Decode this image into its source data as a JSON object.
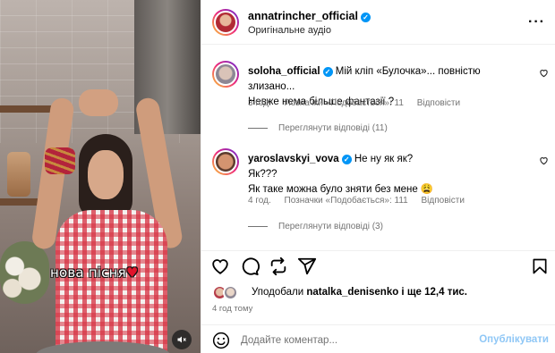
{
  "media": {
    "caption_text": "нова пісня",
    "caption_heart": "♥",
    "mute_icon": "speaker-muted-icon"
  },
  "post": {
    "author": "annatrincher_official",
    "audio_label": "Оригінальне аудіо",
    "more_icon": "more-horizontal-icon"
  },
  "comments": [
    {
      "username": "soloha_official",
      "verified": true,
      "text": "Мій кліп «Булочка»... повністю злизано...",
      "text_line2": "Невже нема більше фантазії ?",
      "time": "3 год.",
      "likes_label": "Позначки «Подобається»: 11",
      "reply_label": "Відповісти",
      "view_replies": "Переглянути відповіді (11)"
    },
    {
      "username": "yaroslavskyi_vova",
      "verified": true,
      "text": "Не ну як як?",
      "text_line2": "Як???",
      "text_line3": "Як таке можна було зняти без мене 😩",
      "time": "4 год.",
      "likes_label": "Позначки «Подобається»: 111",
      "reply_label": "Відповісти",
      "view_replies": "Переглянути відповіді (3)"
    }
  ],
  "actions": {
    "like_icon": "heart-icon",
    "comment_icon": "comment-icon",
    "repost_icon": "repost-icon",
    "share_icon": "send-icon",
    "save_icon": "bookmark-icon"
  },
  "likes": {
    "prefix": "Уподобали ",
    "user": "natalka_denisenko",
    "suffix": " і ще 12,4 тис."
  },
  "time_ago": "4 год тому",
  "comment_box": {
    "placeholder": "Додайте коментар...",
    "publish_label": "Опублікувати",
    "emoji_icon": "emoji-icon"
  },
  "colors": {
    "verified": "#0095f6",
    "publish": "#8fc7f6",
    "muted_text": "#737373"
  }
}
